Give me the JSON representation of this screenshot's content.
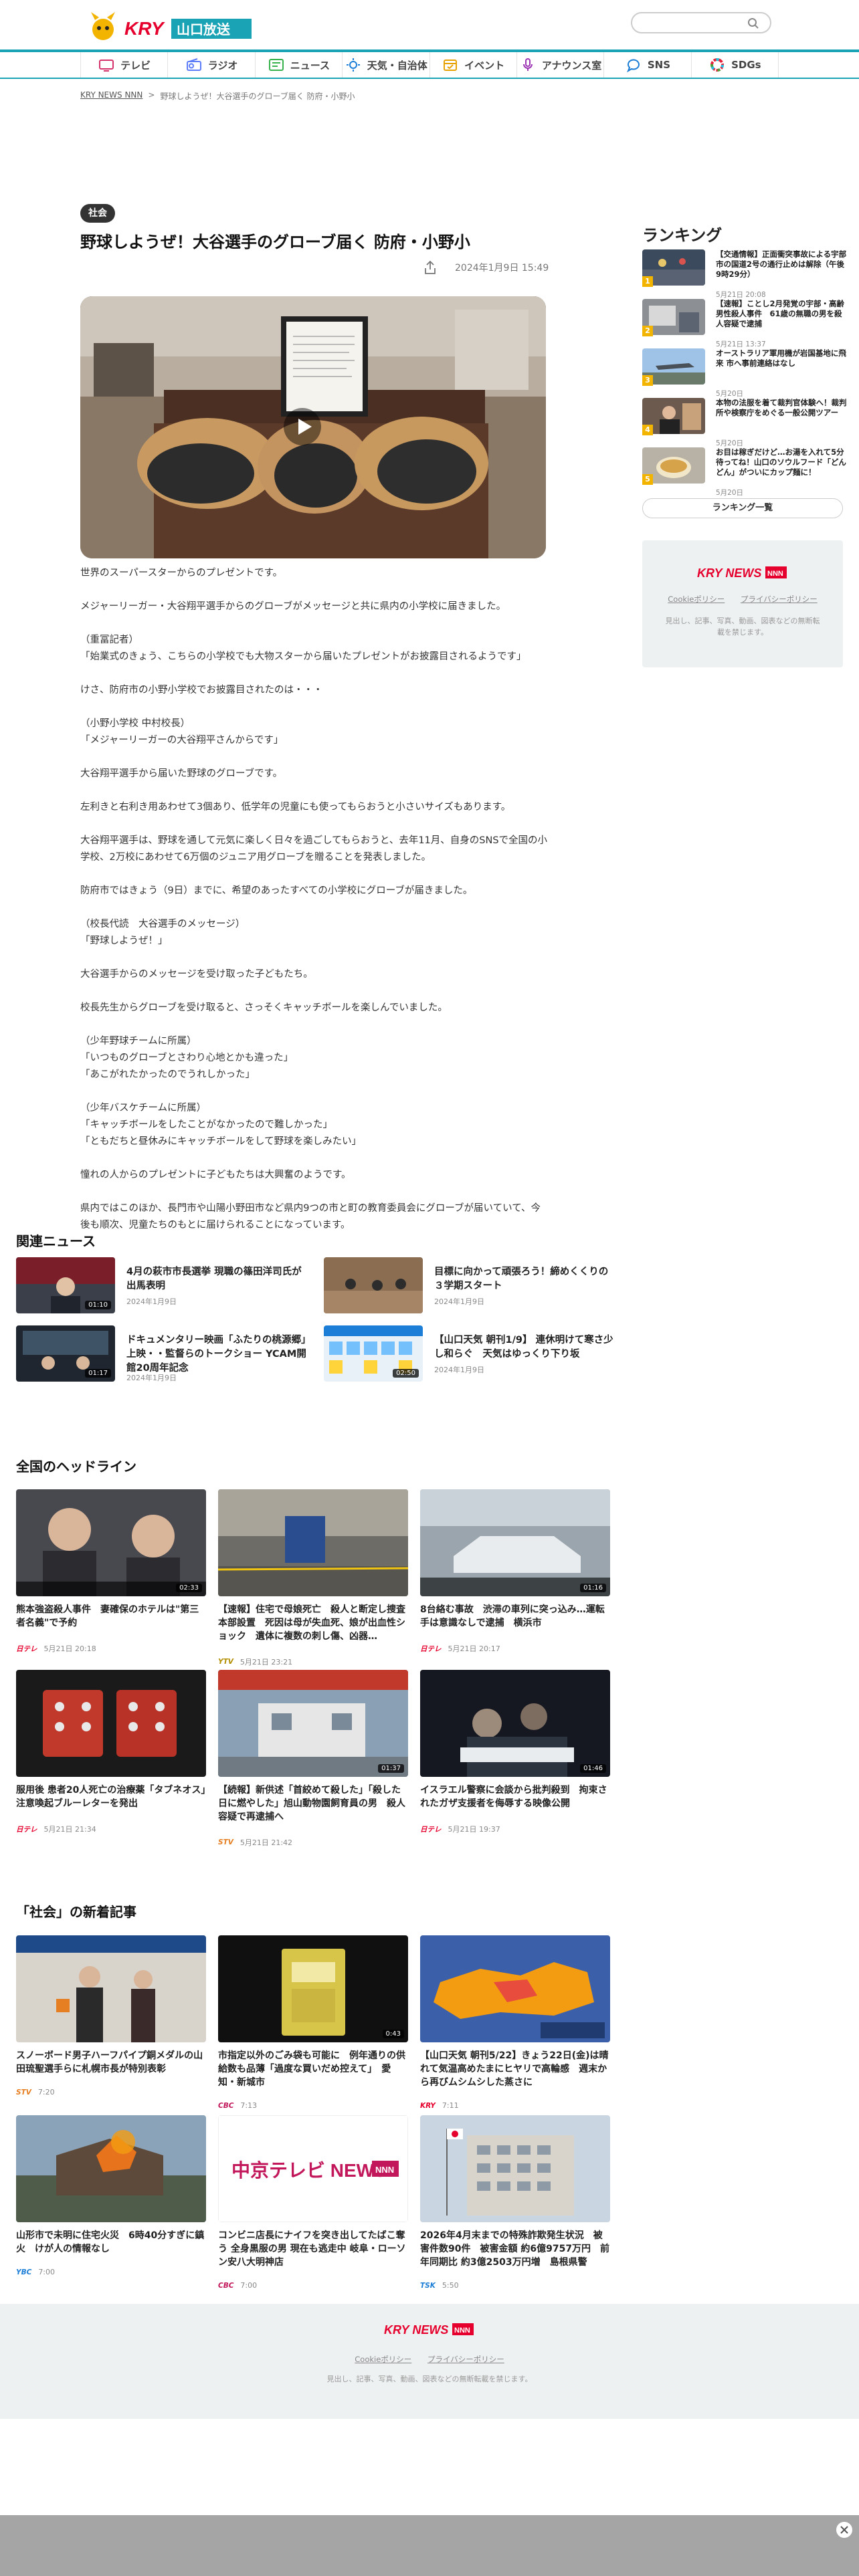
{
  "header": {
    "logo_text": "KRY山口放送",
    "search_placeholder": "",
    "nav": [
      {
        "label": "テレビ",
        "icon": "tv-icon"
      },
      {
        "label": "ラジオ",
        "icon": "radio-icon"
      },
      {
        "label": "ニュース",
        "icon": "news-icon"
      },
      {
        "label": "天気・自治体",
        "icon": "weather-icon"
      },
      {
        "label": "イベント",
        "icon": "event-icon"
      },
      {
        "label": "アナウンス室",
        "icon": "microphone-icon"
      },
      {
        "label": "SNS",
        "icon": "sns-icon"
      },
      {
        "label": "SDGs",
        "icon": "sdgs-icon"
      }
    ]
  },
  "breadcrumb": {
    "home": "KRY NEWS NNN",
    "separator": ">",
    "current": "野球しようぜ！大谷選手のグローブ届く 防府・小野小"
  },
  "article": {
    "category": "社会",
    "title": "野球しようぜ！大谷選手のグローブ届く 防府・小野小",
    "date": "2024年1月9日 15:49",
    "paragraphs": [
      "世界のスーパースターからのプレゼントです。",
      "メジャーリーガー・大谷翔平選手からのグローブがメッセージと共に県内の小学校に届きました。",
      "（重冨記者）\n「始業式のきょう、こちらの小学校でも大物スターから届いたプレゼントがお披露目されるようです」",
      "けさ、防府市の小野小学校でお披露目されたのは・・・",
      "（小野小学校 中村校長）\n「メジャーリーガーの大谷翔平さんからです」",
      "大谷翔平選手から届いた野球のグローブです。",
      "左利きと右利き用あわせて3個あり、低学年の児童にも使ってもらおうと小さいサイズもあります。",
      "大谷翔平選手は、野球を通して元気に楽しく日々を過ごしてもらおうと、去年11月、自身のSNSで全国の小学校、2万校にあわせて6万個のジュニア用グローブを贈ることを発表しました。",
      "防府市ではきょう（9日）までに、希望のあったすべての小学校にグローブが届きました。",
      "（校長代読　大谷選手のメッセージ）\n「野球しようぜ！」",
      "大谷選手からのメッセージを受け取った子どもたち。",
      "校長先生からグローブを受け取ると、さっそくキャッチボールを楽しんでいました。",
      "（少年野球チームに所属）\n「いつものグローブとさわり心地とかも違った」\n「あこがれたかったのでうれしかった」",
      "（少年バスケチームに所属）\n「キャッチボールをしたことがなかったので難しかった」\n「ともだちと昼休みにキャッチボールをして野球を楽しみたい」",
      "憧れの人からのプレゼントに子どもたちは大興奮のようです。",
      "県内ではこのほか、長門市や山陽小野田市など県内9つの市と町の教育委員会にグローブが届いていて、今後も順次、児童たちのもとに届けられることになっています。"
    ]
  },
  "ranking": {
    "title": "ランキング",
    "items": [
      {
        "num": "1",
        "title": "【交通情報】正面衝突事故による宇部市の国道2号の通行止めは解除（午後9時29分）",
        "date": "5月21日 20:08",
        "dur": ""
      },
      {
        "num": "2",
        "title": "【速報】ことし2月発覚の宇部・高齢男性殺人事件　61歳の無職の男を殺人容疑で逮捕",
        "date": "5月21日 13:37",
        "dur": ""
      },
      {
        "num": "3",
        "title": "オーストラリア軍用機が岩国基地に飛来 市へ事前連絡はなし",
        "date": "5月20日",
        "dur": "00:38"
      },
      {
        "num": "4",
        "title": "本物の法服を着て裁判官体験へ！裁判所や検察庁をめぐる一般公開ツアー",
        "date": "5月20日",
        "dur": ""
      },
      {
        "num": "5",
        "title": "お目は稼ぎだけど…お湯を入れて5分待ってね！山口のソウルフード「どんどん」がついにカップ麺に！",
        "date": "5月20日",
        "dur": ""
      }
    ],
    "more_label": "ランキング一覧"
  },
  "sidebar_footer": {
    "logo": "KRY NEWS NNN",
    "cookie": "Cookieポリシー",
    "privacy": "プライバシーポリシー",
    "copyright": "見出し、記事、写真、動画、図表などの無断転載を禁じます。"
  },
  "related": {
    "title": "関連ニュース",
    "items": [
      {
        "title": "4月の萩市市長選挙 現職の篠田洋司氏が出馬表明",
        "date": "2024年1月9日",
        "dur": "01:10"
      },
      {
        "title": "目標に向かって頑張ろう！締めくくりの３学期スタート",
        "date": "2024年1月9日",
        "dur": ""
      },
      {
        "title": "ドキュメンタリー映画「ふたりの桃源郷」上映・・監督らのトークショー YCAM開館20周年記念",
        "date": "2024年1月9日",
        "dur": "01:17"
      },
      {
        "title": "【山口天気 朝刊1/9】 連休明けて寒さ少し和らぐ　天気はゆっくり下り坂",
        "date": "2024年1月9日",
        "dur": "02:50"
      }
    ]
  },
  "headlines": {
    "title": "全国のヘッドライン",
    "items": [
      {
        "title": "熊本強盗殺人事件　妻確保のホテルは\"第三者名義\"で予約",
        "source": "日テレ",
        "date": "5月21日 20:18",
        "dur": "02:33"
      },
      {
        "title": "【速報】住宅で母娘死亡　殺人と断定し捜査本部設置　死因は母が失血死、娘が出血性ショック　遺体に複数の刺し傷、凶器…",
        "source": "YTV",
        "date": "5月21日 23:21",
        "dur": ""
      },
      {
        "title": "8台絡む事故　渋滞の車列に突っ込み…運転手は意識なしで逮捕　横浜市",
        "source": "日テレ",
        "date": "5月21日 20:17",
        "dur": "01:16"
      },
      {
        "title": "服用後 患者20人死亡の治療薬「タブネオス」注意喚起ブルーレターを発出",
        "source": "日テレ",
        "date": "5月21日 21:34",
        "dur": ""
      },
      {
        "title": "【続報】新供述「首絞めて殺した」「殺した日に燃やした」旭山動物園飼育員の男　殺人容疑で再逮捕へ",
        "source": "STV",
        "date": "5月21日 21:42",
        "dur": "01:37"
      },
      {
        "title": "イスラエル警察に会談から批判殺到　拘束されたガザ支援者を侮辱する映像公開",
        "source": "日テレ",
        "date": "5月21日 19:37",
        "dur": "01:46"
      }
    ]
  },
  "social": {
    "title": "「社会」の新着記事",
    "items": [
      {
        "title": "スノーボード男子ハーフパイプ銅メダルの山田琉聖選手らに札幌市長が特別表彰",
        "source": "STV",
        "date": "7:20",
        "dur": ""
      },
      {
        "title": "市指定以外のごみ袋も可能に　例年通りの供給数も品薄「過度な買いだめ控えて」　愛知・新城市",
        "source": "CBC",
        "date": "7:13",
        "dur": "0:43"
      },
      {
        "title": "【山口天気 朝刊5/22】きょう22日(金)は晴れて気温高めたまにヒヤリで高輪感　週末から再びムシムシした蒸さに",
        "source": "KRY",
        "date": "7:11",
        "dur": ""
      },
      {
        "title": "山形市で未明に住宅火災　6時40分すぎに鎮火　けが人の情報なし",
        "source": "YBC",
        "date": "7:00",
        "dur": ""
      },
      {
        "title": "コンビニ店長にナイフを突き出してたばこ奪う 全身黒服の男 現在も逃走中 岐阜・ローソン安八大明神店",
        "source": "CBC",
        "date": "7:00",
        "dur": ""
      },
      {
        "title": "2026年4月末までの特殊詐欺発生状況　被害件数90件　被害金額 約6億9757万円　前年同期比 約3億2503万円増　島根県警",
        "source": "TSK",
        "date": "5:50",
        "dur": ""
      }
    ]
  },
  "footer": {
    "logo": "KRY NEWS NNN",
    "cookie": "Cookieポリシー",
    "privacy": "プライバシーポリシー",
    "copyright": "見出し、記事、写真、動画、図表などの無断転載を禁じます。"
  },
  "colors": {
    "accent": "#19a3b5",
    "kry_red": "#e6002d",
    "logo_yellow": "#f3b400",
    "badge": "#333333"
  }
}
